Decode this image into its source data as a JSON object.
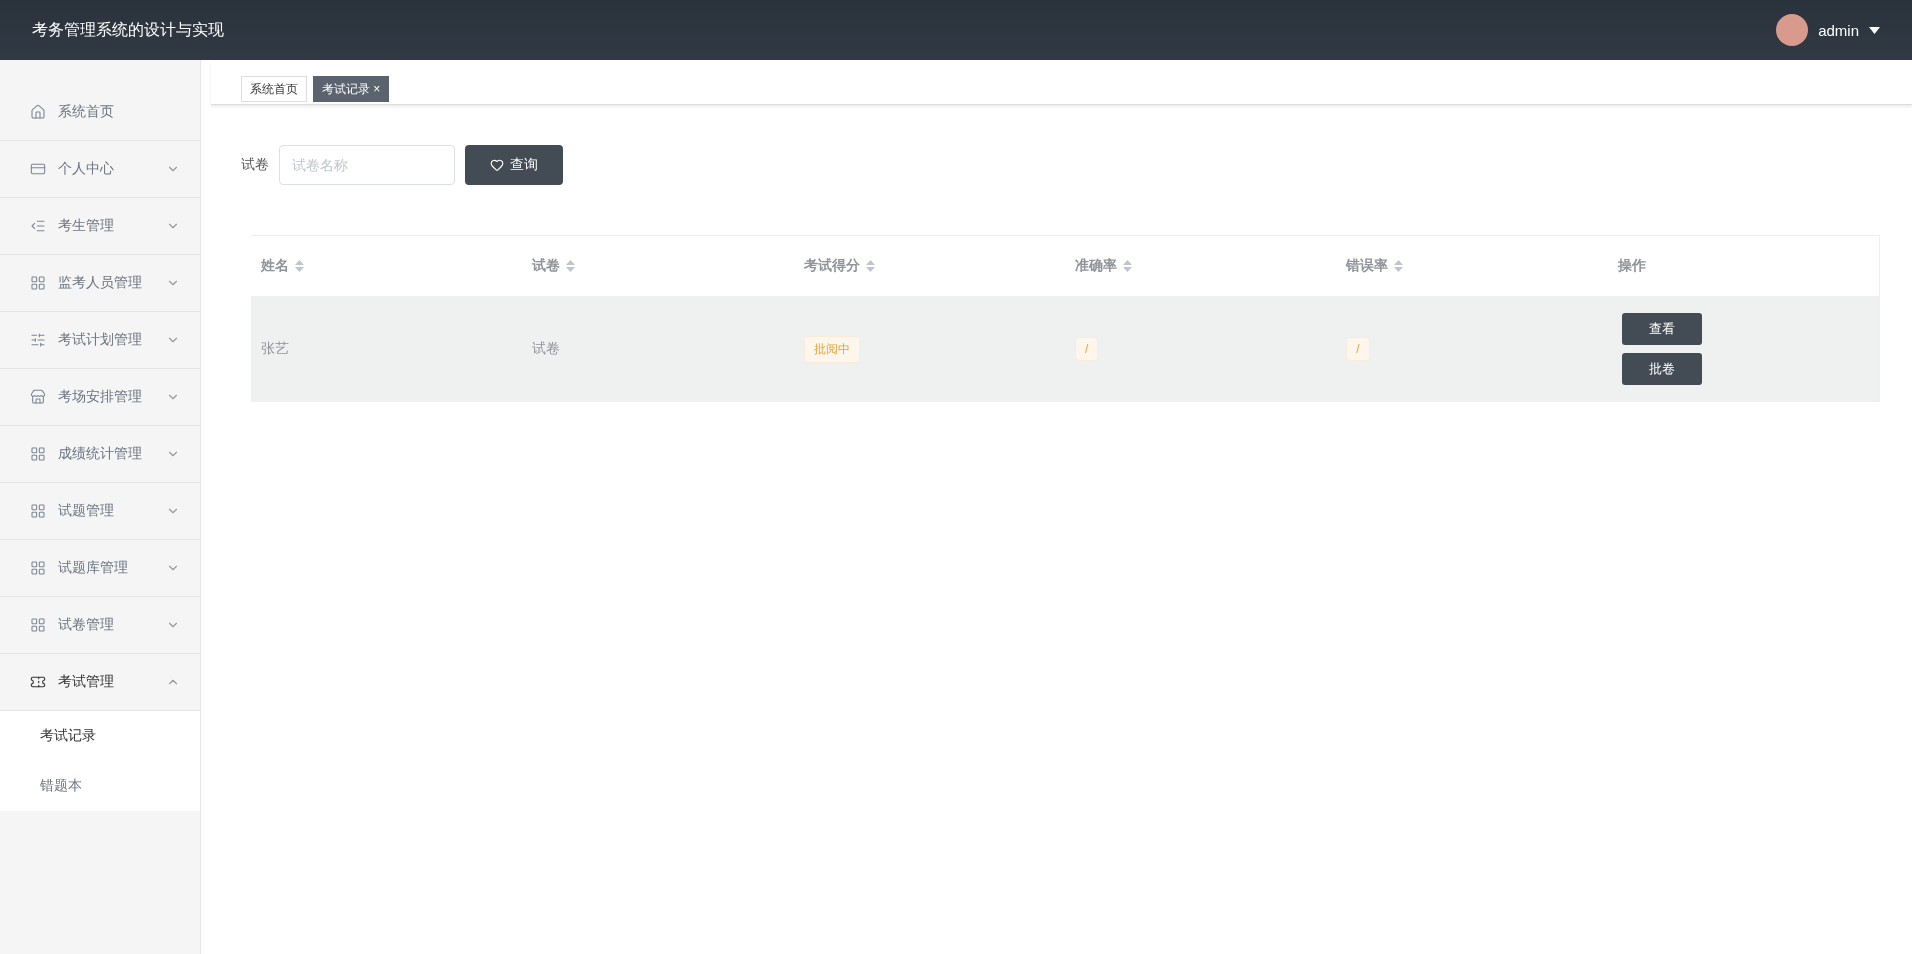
{
  "header": {
    "title": "考务管理系统的设计与实现",
    "user": "admin"
  },
  "sidebar": {
    "items": [
      {
        "label": "系统首页",
        "kind": "link",
        "expanded": false
      },
      {
        "label": "个人中心",
        "kind": "submenu",
        "expanded": false
      },
      {
        "label": "考生管理",
        "kind": "submenu",
        "expanded": false
      },
      {
        "label": "监考人员管理",
        "kind": "submenu",
        "expanded": false
      },
      {
        "label": "考试计划管理",
        "kind": "submenu",
        "expanded": false
      },
      {
        "label": "考场安排管理",
        "kind": "submenu",
        "expanded": false
      },
      {
        "label": "成绩统计管理",
        "kind": "submenu",
        "expanded": false
      },
      {
        "label": "试题管理",
        "kind": "submenu",
        "expanded": false
      },
      {
        "label": "试题库管理",
        "kind": "submenu",
        "expanded": false
      },
      {
        "label": "试卷管理",
        "kind": "submenu",
        "expanded": false
      },
      {
        "label": "考试管理",
        "kind": "submenu",
        "expanded": true,
        "children": [
          {
            "label": "考试记录",
            "selected": true
          },
          {
            "label": "错题本",
            "selected": false
          }
        ]
      }
    ]
  },
  "tabs": [
    {
      "label": "系统首页",
      "selected": false
    },
    {
      "label": "考试记录",
      "selected": true,
      "close": "×"
    }
  ],
  "search": {
    "label": "试卷",
    "placeholder": "试卷名称",
    "button": "查询"
  },
  "table": {
    "columns": [
      {
        "label": "姓名",
        "sortable": true
      },
      {
        "label": "试卷",
        "sortable": true
      },
      {
        "label": "考试得分",
        "sortable": true
      },
      {
        "label": "准确率",
        "sortable": true
      },
      {
        "label": "错误率",
        "sortable": true
      },
      {
        "label": "操作",
        "sortable": false
      }
    ],
    "rows": [
      {
        "cells": [
          {
            "kind": "text",
            "text": "张艺"
          },
          {
            "kind": "text",
            "text": "试卷"
          },
          {
            "kind": "tag",
            "text": "批阅中"
          },
          {
            "kind": "tag",
            "text": "/"
          },
          {
            "kind": "tag",
            "text": "/"
          }
        ],
        "actions": [
          "查看",
          "批卷"
        ]
      }
    ]
  }
}
